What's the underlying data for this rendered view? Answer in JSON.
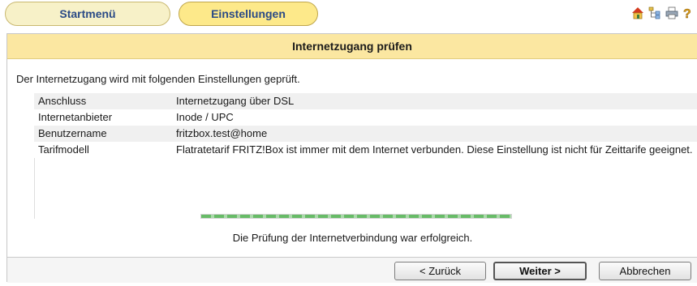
{
  "tabs": [
    {
      "label": "Startmenü"
    },
    {
      "label": "Einstellungen"
    }
  ],
  "top_icons": [
    "home-icon",
    "sitemap-icon",
    "printer-icon",
    "help-icon"
  ],
  "header": {
    "title": "Internetzugang prüfen"
  },
  "intro": "Der Internetzugang wird mit folgenden Einstellungen geprüft.",
  "settings": [
    {
      "key": "Anschluss",
      "value": "Internetzugang über DSL"
    },
    {
      "key": "Internetanbieter",
      "value": "Inode / UPC"
    },
    {
      "key": "Benutzername",
      "value": "fritzbox.test@home"
    },
    {
      "key": "Tarifmodell",
      "value": "Flatratetarif FRITZ!Box ist immer mit dem Internet verbunden. Diese Einstellung ist nicht für Zeittarife geeignet."
    }
  ],
  "progress": {
    "fraction": 1.0
  },
  "result": "Die Prüfung der Internetverbindung war erfolgreich.",
  "buttons": {
    "back": "< Zurück",
    "next": "Weiter >",
    "cancel": "Abbrechen"
  },
  "colors": {
    "accent_tab": "#fde98a",
    "header": "#fbe7a1",
    "progress": "#67bb67",
    "link_text": "#2a4a86"
  }
}
